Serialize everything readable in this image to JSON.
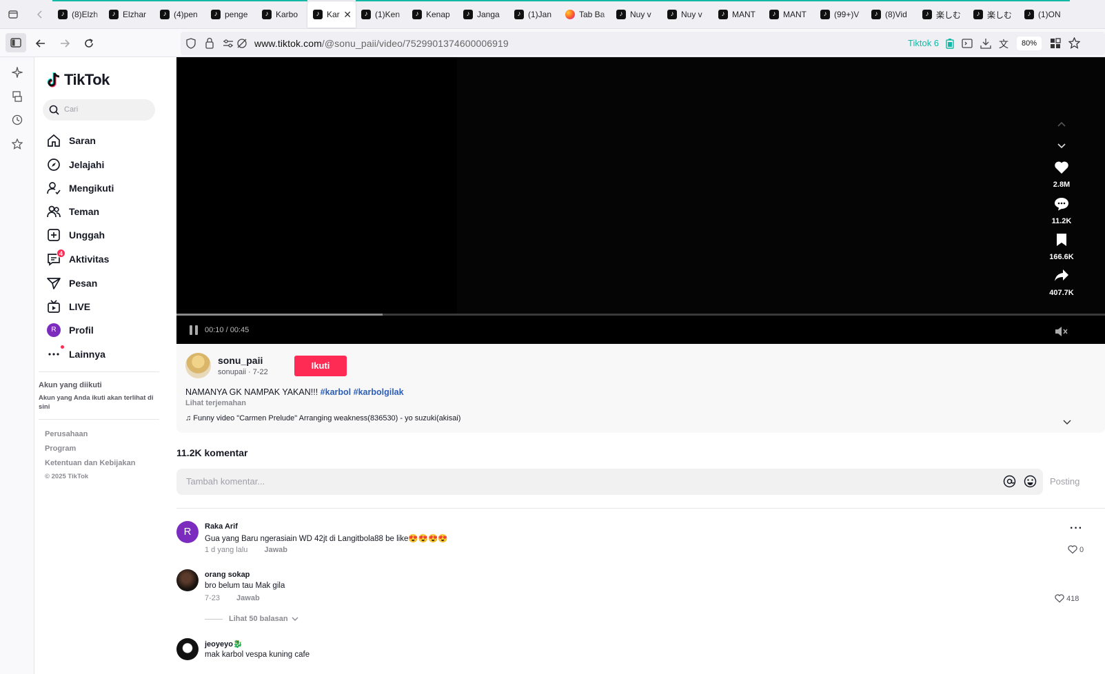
{
  "browser": {
    "tabs": [
      {
        "label": "(8)Elzh",
        "fav": "tiktok"
      },
      {
        "label": "Elzhar",
        "fav": "tiktok"
      },
      {
        "label": "(4)pen",
        "fav": "tiktok"
      },
      {
        "label": "penge",
        "fav": "tiktok"
      },
      {
        "label": "Karbo",
        "fav": "tiktok"
      },
      {
        "label": "Kar",
        "fav": "tiktok",
        "active": true
      },
      {
        "label": "(1)Ken",
        "fav": "tiktok"
      },
      {
        "label": "Kenap",
        "fav": "tiktok"
      },
      {
        "label": "Janga",
        "fav": "tiktok"
      },
      {
        "label": "(1)Jan",
        "fav": "tiktok"
      },
      {
        "label": "Tab Ba",
        "fav": "firefox"
      },
      {
        "label": "Nuy v",
        "fav": "tiktok"
      },
      {
        "label": "Nuy v",
        "fav": "tiktok"
      },
      {
        "label": "MANT",
        "fav": "tiktok"
      },
      {
        "label": "MANT",
        "fav": "tiktok"
      },
      {
        "label": "(99+)V",
        "fav": "tiktok"
      },
      {
        "label": "(8)Vid",
        "fav": "tiktok"
      },
      {
        "label": "楽しむ",
        "fav": "tiktok"
      },
      {
        "label": "楽しむ",
        "fav": "tiktok"
      },
      {
        "label": "(1)ON",
        "fav": "tiktok"
      }
    ],
    "url_host": "www.tiktok.com",
    "url_path": "/@sonu_paii/video/7529901374600006919",
    "extension_label": "Tiktok 6",
    "zoom": "80%"
  },
  "sidebar": {
    "logo": "TikTok",
    "search_placeholder": "Cari",
    "items": [
      {
        "label": "Saran",
        "icon": "home-icon"
      },
      {
        "label": "Jelajahi",
        "icon": "compass-icon"
      },
      {
        "label": "Mengikuti",
        "icon": "following-icon"
      },
      {
        "label": "Teman",
        "icon": "friends-icon"
      },
      {
        "label": "Unggah",
        "icon": "upload-icon"
      },
      {
        "label": "Aktivitas",
        "icon": "activity-icon",
        "badge": "4"
      },
      {
        "label": "Pesan",
        "icon": "message-icon"
      },
      {
        "label": "LIVE",
        "icon": "live-icon"
      },
      {
        "label": "Profil",
        "icon": "avatar-icon",
        "avatar_letter": "R"
      },
      {
        "label": "Lainnya",
        "icon": "more-icon"
      }
    ],
    "following_title": "Akun yang diikuti",
    "following_hint": "Akun yang Anda ikuti akan terlihat di sini",
    "footer": [
      "Perusahaan",
      "Program",
      "Ketentuan dan Kebijakan"
    ],
    "copyright": "© 2025 TikTok"
  },
  "video": {
    "time": "00:10 / 00:45",
    "progress": 0.222,
    "likes": "2.8M",
    "comments": "11.2K",
    "saves": "166.6K",
    "shares": "407.7K"
  },
  "post": {
    "username": "sonu_paii",
    "subline": "sonupaii · 7-22",
    "follow_label": "Ikuti",
    "caption": "NAMANYA GK NAMPAK YAKAN!!!",
    "hashtags": [
      "#karbol",
      "#karbolgilak"
    ],
    "translate": "Lihat terjemahan",
    "music": "♫ Funny video \"Carmen Prelude\" Arranging weakness(836530) - yo suzuki(akisai)"
  },
  "comments_section": {
    "count_label": "11.2K komentar",
    "input_placeholder": "Tambah komentar...",
    "post_label": "Posting",
    "items": [
      {
        "name": "Raka Arif",
        "text": "Gua yang Baru ngerasiain WD 42jt di Langitbola88 be like😍😍😍😍",
        "date": "1 d yang lalu",
        "reply": "Jawab",
        "avatar_letter": "R",
        "likes": "0"
      },
      {
        "name": "orang sokap",
        "text": "bro belum tau Mak gila",
        "date": "7-23",
        "reply": "Jawab",
        "likes": "418",
        "view_replies": "Lihat 50 balasan"
      },
      {
        "name": "jeoyeyo🐉",
        "text": "mak karbol vespa kuning cafe"
      }
    ]
  },
  "colors": {
    "accent": "#fe2c55",
    "hashtag": "#2b5db9",
    "teal": "#14b8a6"
  }
}
